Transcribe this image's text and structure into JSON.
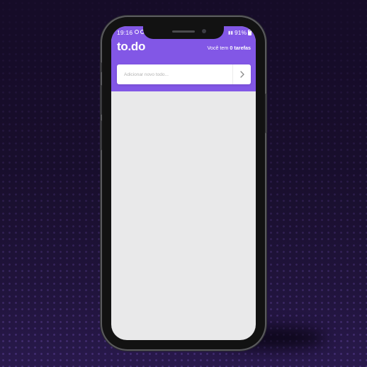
{
  "status_bar": {
    "time": "19:16",
    "battery": "91%"
  },
  "header": {
    "logo": "to.do",
    "task_count_prefix": "Você tem",
    "task_count_value": "0 tarefas"
  },
  "new_todo": {
    "placeholder": "Adicionar novo todo...",
    "value": ""
  },
  "icons": {
    "submit": "chevron-right-icon"
  },
  "colors": {
    "accent": "#8257e6",
    "list_background": "#e9e9ea",
    "page_background": "#1a0f2e"
  }
}
